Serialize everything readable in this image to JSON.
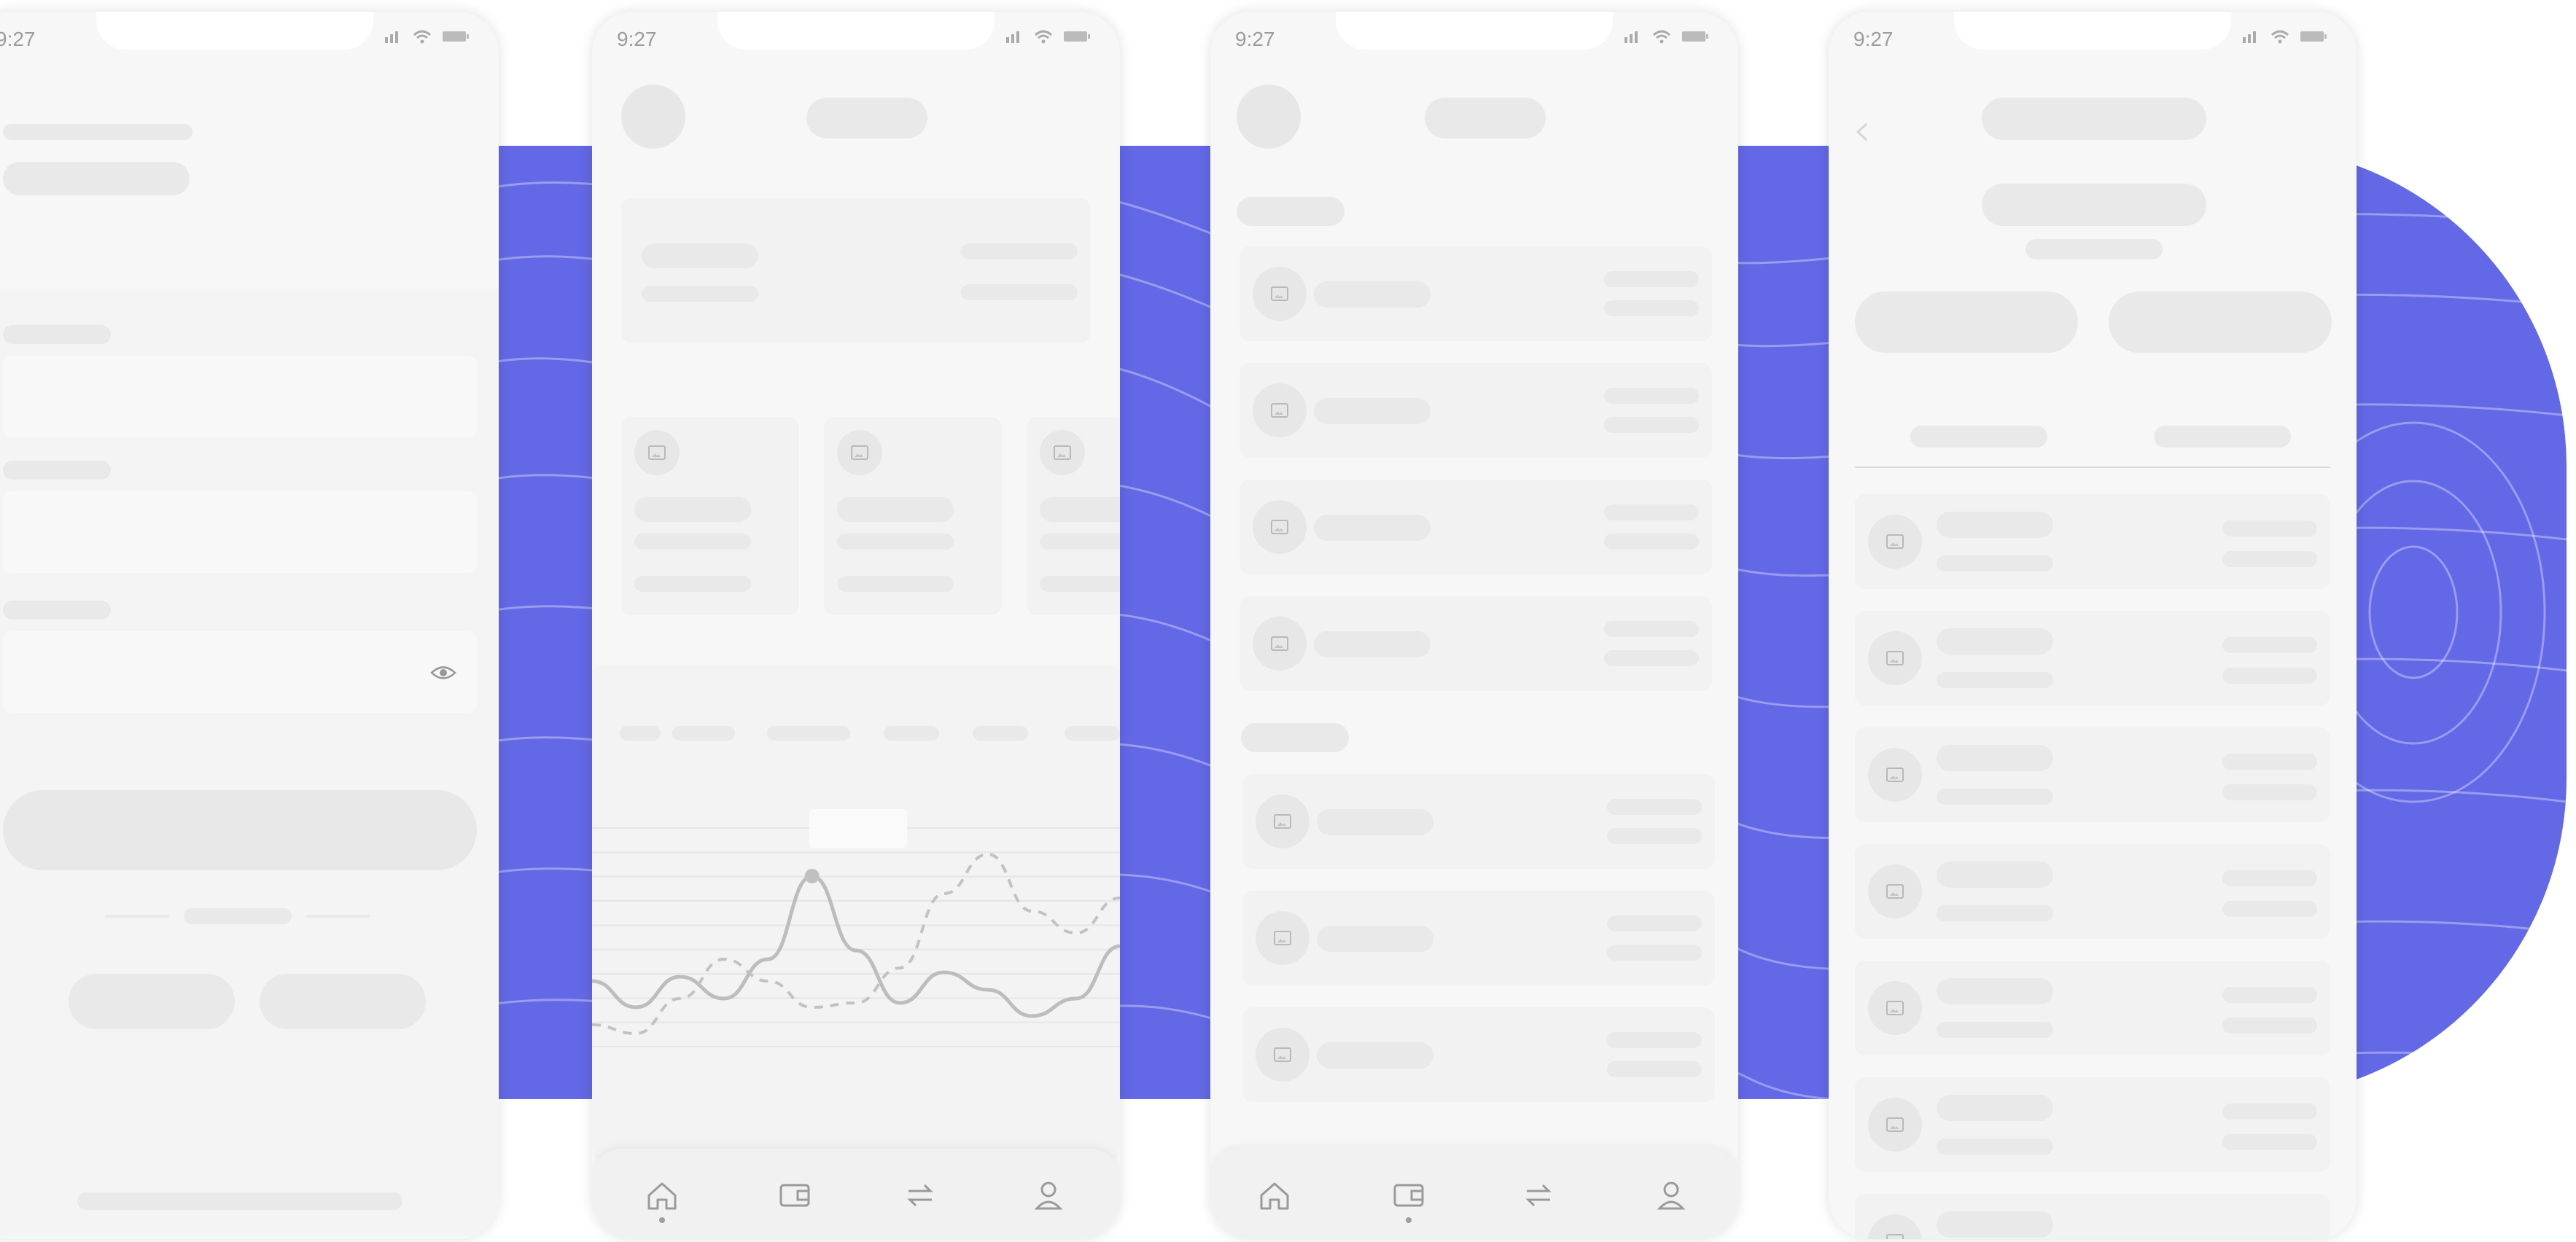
{
  "screen": {
    "background": "#ffffff",
    "accent": "#6368e6"
  },
  "status_bar": {
    "time": "9:27",
    "icons": [
      "signal-icon",
      "wifi-icon",
      "battery-icon"
    ]
  },
  "phones": [
    {
      "id": "login",
      "fields": 3,
      "password_toggle_icon": "eye-icon",
      "social_buttons": 2
    },
    {
      "id": "dashboard",
      "nav_items": [
        "home-icon",
        "wallet-icon",
        "transfer-icon",
        "profile-icon"
      ],
      "active_nav": "home"
    },
    {
      "id": "wallet-list",
      "nav_items": [
        "home-icon",
        "wallet-icon",
        "transfer-icon",
        "profile-icon"
      ],
      "active_nav": "wallet"
    },
    {
      "id": "transactions",
      "back_icon": "back-icon",
      "action_buttons": 2,
      "tabs": 2
    }
  ],
  "chart_data": {
    "type": "line",
    "title": "",
    "xlabel": "",
    "ylabel": "",
    "series": [
      {
        "style": "solid",
        "values": [
          0.3,
          0.18,
          0.32,
          0.22,
          0.4,
          0.78,
          0.44,
          0.2,
          0.34,
          0.26,
          0.14,
          0.22,
          0.46
        ]
      },
      {
        "style": "dashed",
        "values": [
          0.1,
          0.06,
          0.22,
          0.4,
          0.3,
          0.18,
          0.2,
          0.36,
          0.7,
          0.88,
          0.62,
          0.52,
          0.68
        ]
      }
    ],
    "highlight_index": 5,
    "grid": true
  }
}
